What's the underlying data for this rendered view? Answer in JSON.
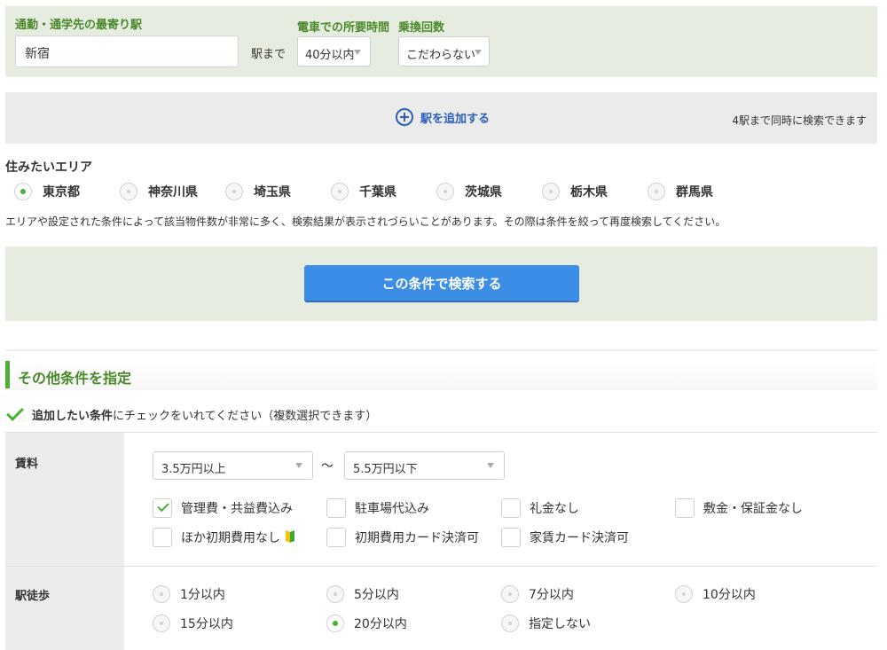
{
  "station": {
    "label": "通勤・通学先の最寄り駅",
    "value": "新宿",
    "suffix": "駅まで",
    "time_label": "電車での所要時間",
    "time_value": "40分以内",
    "transfer_label": "乗換回数",
    "transfer_value": "こだわらない"
  },
  "add_station": {
    "label": "駅を追加する",
    "note": "4駅まで同時に検索できます"
  },
  "area": {
    "title": "住みたいエリア",
    "options": [
      {
        "label": "東京都",
        "selected": true
      },
      {
        "label": "神奈川県",
        "selected": false
      },
      {
        "label": "埼玉県",
        "selected": false
      },
      {
        "label": "千葉県",
        "selected": false
      },
      {
        "label": "茨城県",
        "selected": false
      },
      {
        "label": "栃木県",
        "selected": false
      },
      {
        "label": "群馬県",
        "selected": false
      }
    ],
    "notice": "エリアや設定された条件によって該当物件数が非常に多く、検索結果が表示されづらいことがあります。その際は条件を絞って再度検索してください。"
  },
  "search_button": "この条件で検索する",
  "other": {
    "title": "その他条件を指定",
    "intro_bold": "追加したい条件",
    "intro_rest": "にチェックをいれてください（複数選択できます）"
  },
  "rent": {
    "label": "賃料",
    "min": "3.5万円以上",
    "tilde": "〜",
    "max": "5.5万円以下",
    "checkboxes": [
      {
        "label": "管理費・共益費込み",
        "checked": true
      },
      {
        "label": "駐車場代込み",
        "checked": false
      },
      {
        "label": "礼金なし",
        "checked": false
      },
      {
        "label": "敷金・保証金なし",
        "checked": false
      },
      {
        "label": "ほか初期費用なし",
        "checked": false,
        "icon": "beginner-mark-icon"
      },
      {
        "label": "初期費用カード決済可",
        "checked": false
      },
      {
        "label": "家賃カード決済可",
        "checked": false
      }
    ]
  },
  "walk": {
    "label": "駅徒歩",
    "options": [
      {
        "label": "1分以内",
        "selected": false
      },
      {
        "label": "5分以内",
        "selected": false
      },
      {
        "label": "7分以内",
        "selected": false
      },
      {
        "label": "10分以内",
        "selected": false
      },
      {
        "label": "15分以内",
        "selected": false
      },
      {
        "label": "20分以内",
        "selected": true
      },
      {
        "label": "指定しない",
        "selected": false
      }
    ]
  },
  "colors": {
    "accent_green": "#4cb034",
    "label_green": "#4a8a2a",
    "button_blue": "#3c8de6",
    "link_blue": "#2c5fb8",
    "panel_green": "#e6ede0"
  }
}
